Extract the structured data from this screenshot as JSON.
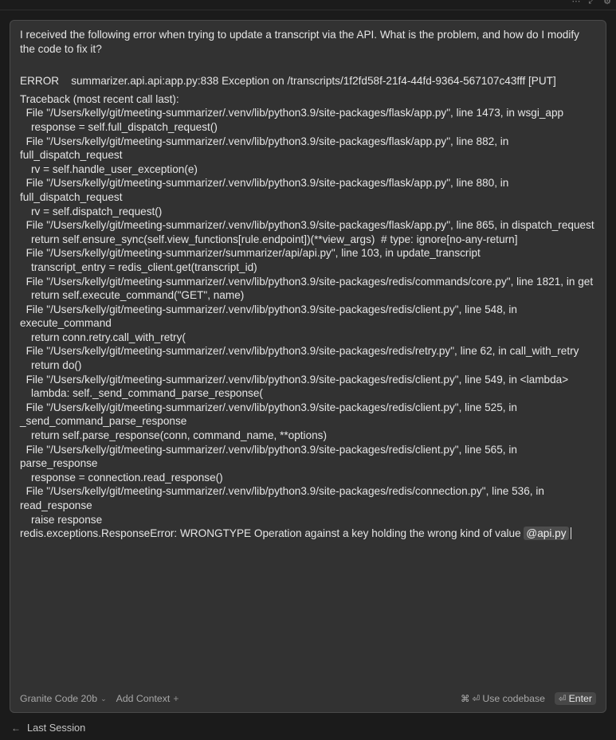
{
  "prompt": {
    "intro": "I received the following error when trying to update a transcript via the API. What is the problem, and how do I modify the code to fix it?",
    "error_header": "ERROR    summarizer.api.api:app.py:838 Exception on /transcripts/1f2fd58f-21f4-44fd-9364-567107c43fff [PUT]",
    "traceback_title": "Traceback (most recent call last):",
    "frames": [
      {
        "file": "  File \"/Users/kelly/git/meeting-summarizer/.venv/lib/python3.9/site-packages/flask/app.py\", line 1473, in wsgi_app",
        "code": "response = self.full_dispatch_request()"
      },
      {
        "file": "  File \"/Users/kelly/git/meeting-summarizer/.venv/lib/python3.9/site-packages/flask/app.py\", line 882, in full_dispatch_request",
        "code": "rv = self.handle_user_exception(e)"
      },
      {
        "file": "  File \"/Users/kelly/git/meeting-summarizer/.venv/lib/python3.9/site-packages/flask/app.py\", line 880, in full_dispatch_request",
        "code": "rv = self.dispatch_request()"
      },
      {
        "file": "  File \"/Users/kelly/git/meeting-summarizer/.venv/lib/python3.9/site-packages/flask/app.py\", line 865, in dispatch_request",
        "code": "return self.ensure_sync(self.view_functions[rule.endpoint])(**view_args)  # type: ignore[no-any-return]"
      },
      {
        "file": "  File \"/Users/kelly/git/meeting-summarizer/summarizer/api/api.py\", line 103, in update_transcript",
        "code": "transcript_entry = redis_client.get(transcript_id)"
      },
      {
        "file": "  File \"/Users/kelly/git/meeting-summarizer/.venv/lib/python3.9/site-packages/redis/commands/core.py\", line 1821, in get",
        "code": "return self.execute_command(\"GET\", name)"
      },
      {
        "file": "  File \"/Users/kelly/git/meeting-summarizer/.venv/lib/python3.9/site-packages/redis/client.py\", line 548, in execute_command",
        "code": "return conn.retry.call_with_retry("
      },
      {
        "file": "  File \"/Users/kelly/git/meeting-summarizer/.venv/lib/python3.9/site-packages/redis/retry.py\", line 62, in call_with_retry",
        "code": "return do()"
      },
      {
        "file": "  File \"/Users/kelly/git/meeting-summarizer/.venv/lib/python3.9/site-packages/redis/client.py\", line 549, in <lambda>",
        "code": "lambda: self._send_command_parse_response("
      },
      {
        "file": "  File \"/Users/kelly/git/meeting-summarizer/.venv/lib/python3.9/site-packages/redis/client.py\", line 525, in _send_command_parse_response",
        "code": "return self.parse_response(conn, command_name, **options)"
      },
      {
        "file": "  File \"/Users/kelly/git/meeting-summarizer/.venv/lib/python3.9/site-packages/redis/client.py\", line 565, in parse_response",
        "code": "response = connection.read_response()"
      },
      {
        "file": "  File \"/Users/kelly/git/meeting-summarizer/.venv/lib/python3.9/site-packages/redis/connection.py\", line 536, in read_response",
        "code": "raise response"
      }
    ],
    "final_error": "redis.exceptions.ResponseError: WRONGTYPE Operation against a key holding the wrong kind of value ",
    "mention": "@api.py"
  },
  "footer": {
    "model": "Granite Code 20b",
    "add_context": "Add Context",
    "use_codebase_keys": "⌘ ⏎",
    "use_codebase": "Use codebase",
    "enter_glyph": "⏎",
    "enter": "Enter"
  },
  "last_session": "Last Session",
  "icons": {
    "chevron": "chevron-down-icon",
    "plus": "plus-icon",
    "arrow": "arrow-left-icon"
  }
}
